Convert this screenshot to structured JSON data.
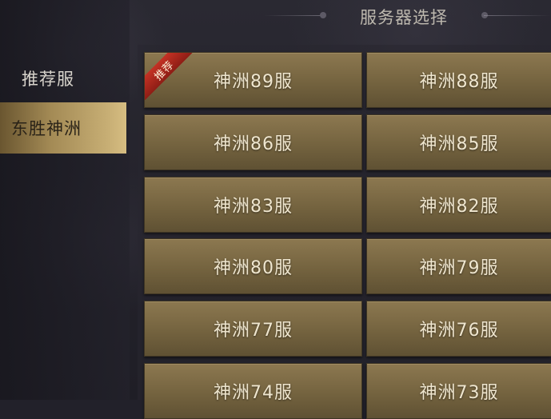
{
  "header": {
    "title": "服务器选择"
  },
  "sidebar": {
    "items": [
      {
        "label": "推荐服",
        "active": false
      },
      {
        "label": "东胜神洲",
        "active": true
      }
    ]
  },
  "servers": [
    {
      "name": "神洲89服",
      "badge": "推荐"
    },
    {
      "name": "神洲88服"
    },
    {
      "name": "神洲86服"
    },
    {
      "name": "神洲85服"
    },
    {
      "name": "神洲83服"
    },
    {
      "name": "神洲82服"
    },
    {
      "name": "神洲80服"
    },
    {
      "name": "神洲79服"
    },
    {
      "name": "神洲77服"
    },
    {
      "name": "神洲76服"
    },
    {
      "name": "神洲74服"
    },
    {
      "name": "神洲73服"
    }
  ],
  "colors": {
    "accent_gold": "#c7ae74",
    "badge_red": "#c43224",
    "tile": "#74633f"
  }
}
